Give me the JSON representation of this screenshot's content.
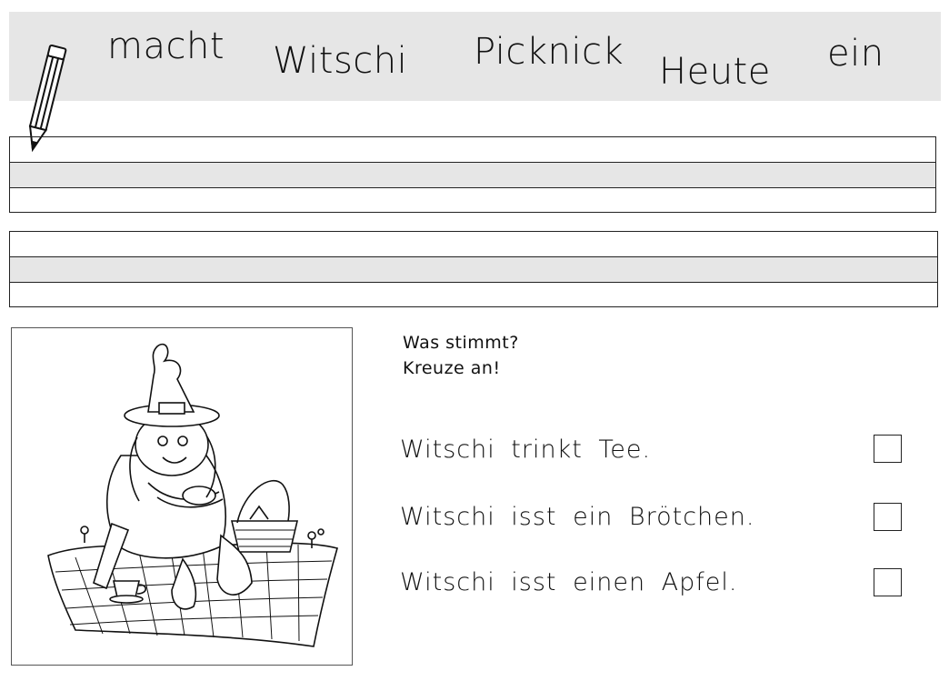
{
  "word_band": {
    "words": [
      "macht",
      "Witschi",
      "Picknick",
      "Heute",
      "ein"
    ]
  },
  "instructions": {
    "line1": "Was stimmt?",
    "line2": "Kreuze an!"
  },
  "statements": [
    {
      "text": "Witschi trinkt Tee.",
      "checked": false
    },
    {
      "text": "Witschi isst ein Brötchen.",
      "checked": false
    },
    {
      "text": "Witschi isst einen Apfel.",
      "checked": false
    }
  ]
}
